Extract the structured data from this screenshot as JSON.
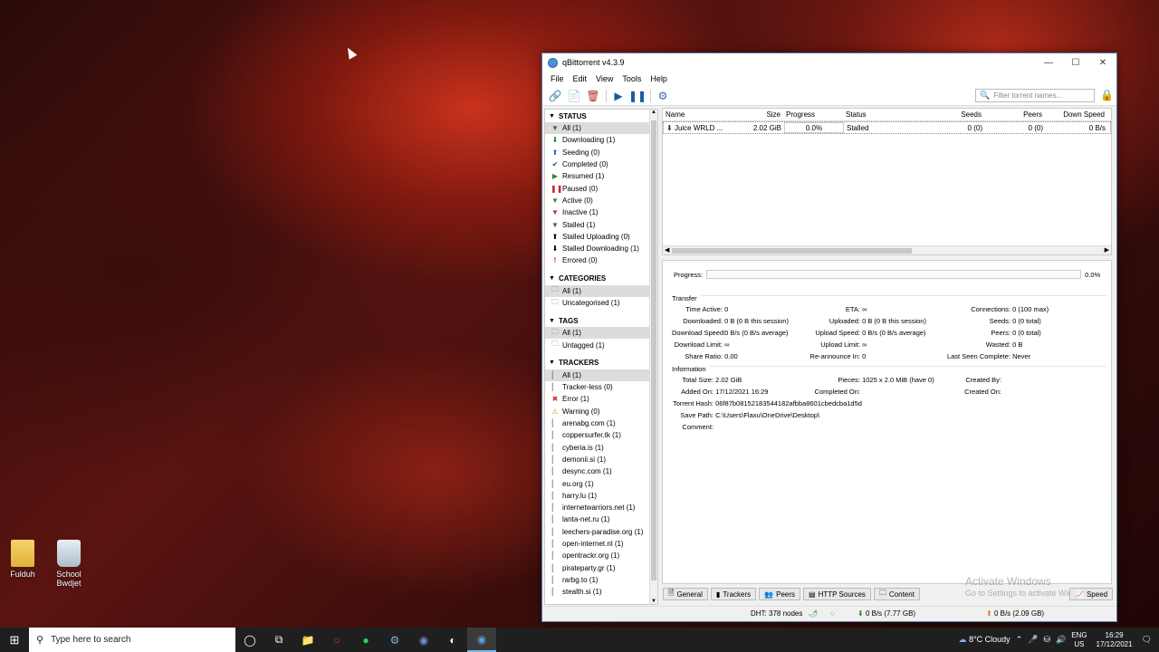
{
  "desktop": {
    "icons": [
      {
        "label": "Fulduh"
      },
      {
        "label": "School Bwdjet"
      }
    ]
  },
  "window": {
    "title": "qBittorrent v4.3.9",
    "menu": [
      "File",
      "Edit",
      "View",
      "Tools",
      "Help"
    ],
    "search_placeholder": "Filter torrent names..."
  },
  "sidebar": {
    "status_title": "STATUS",
    "status": [
      "All (1)",
      "Downloading (1)",
      "Seeding (0)",
      "Completed (0)",
      "Resumed (1)",
      "Paused (0)",
      "Active (0)",
      "Inactive (1)",
      "Stalled (1)",
      "Stalled Uploading (0)",
      "Stalled Downloading (1)",
      "Errored (0)"
    ],
    "categories_title": "CATEGORIES",
    "categories": [
      "All (1)",
      "Uncategorised (1)"
    ],
    "tags_title": "TAGS",
    "tags": [
      "All (1)",
      "Untagged (1)"
    ],
    "trackers_title": "TRACKERS",
    "trackers": [
      "All (1)",
      "Tracker-less (0)",
      "Error (1)",
      "Warning (0)",
      "arenabg.com (1)",
      "coppersurfer.tk (1)",
      "cyberia.is (1)",
      "demonii.si (1)",
      "desync.com (1)",
      "eu.org (1)",
      "harry.lu (1)",
      "internetwarriors.net (1)",
      "lanta-net.ru (1)",
      "leechers-paradise.org (1)",
      "open-internet.nl (1)",
      "opentrackr.org (1)",
      "pirateparty.gr (1)",
      "rarbg.to (1)",
      "stealth.si (1)"
    ]
  },
  "torrents": {
    "columns": [
      "Name",
      "Size",
      "Progress",
      "Status",
      "Seeds",
      "Peers",
      "Down Speed"
    ],
    "rows": [
      {
        "name": "Juice WRLD ...",
        "size": "2.02 GiB",
        "progress": "0.0%",
        "status": "Stalled",
        "seeds": "0 (0)",
        "peers": "0 (0)",
        "down_speed": "0 B/s"
      }
    ]
  },
  "details": {
    "progress_label": "Progress:",
    "progress_value": "0.0%",
    "transfer_title": "Transfer",
    "transfer": {
      "time_active": [
        "Time Active:",
        "0"
      ],
      "downloaded": [
        "Downloaded:",
        "0 B (0 B this session)"
      ],
      "download_speed": [
        "Download Speed:",
        "0 B/s (0 B/s average)"
      ],
      "download_limit": [
        "Download Limit:",
        "∞"
      ],
      "share_ratio": [
        "Share Ratio:",
        "0.00"
      ],
      "eta": [
        "ETA:",
        "∞"
      ],
      "uploaded": [
        "Uploaded:",
        "0 B (0 B this session)"
      ],
      "upload_speed": [
        "Upload Speed:",
        "0 B/s (0 B/s average)"
      ],
      "upload_limit": [
        "Upload Limit:",
        "∞"
      ],
      "reannounce": [
        "Re-announce In:",
        "0"
      ],
      "connections": [
        "Connections:",
        "0 (100 max)"
      ],
      "seeds": [
        "Seeds:",
        "0 (0 total)"
      ],
      "peers": [
        "Peers:",
        "0 (0 total)"
      ],
      "wasted": [
        "Wasted:",
        "0 B"
      ],
      "last_seen": [
        "Last Seen Complete:",
        "Never"
      ]
    },
    "info_title": "Information",
    "info": {
      "total_size": [
        "Total Size:",
        "2.02 GiB"
      ],
      "added_on": [
        "Added On:",
        "17/12/2021 16:29"
      ],
      "hash": [
        "Torrent Hash:",
        "06f87b08152183544182afbba8601cbedcba1d5d"
      ],
      "save_path": [
        "Save Path:",
        "C:\\Users\\Flaxu\\OneDrive\\Desktop\\"
      ],
      "comment": [
        "Comment:",
        ""
      ],
      "pieces": [
        "Pieces:",
        "1025 x 2.0 MiB (have 0)"
      ],
      "completed_on": [
        "Completed On:",
        ""
      ],
      "created_by": [
        "Created By:",
        ""
      ],
      "created_on": [
        "Created On:",
        ""
      ]
    },
    "watermark_1": "Activate Windows",
    "watermark_2": "Go to Settings to activate Windows."
  },
  "tabs": [
    "General",
    "Trackers",
    "Peers",
    "HTTP Sources",
    "Content"
  ],
  "speed_tab": "Speed",
  "statusbar": {
    "dht": "DHT: 378 nodes",
    "down": "0 B/s (7.77 GB)",
    "up": "0 B/s (2.09 GB)"
  },
  "taskbar": {
    "search_placeholder": "Type here to search",
    "weather": "8°C  Cloudy",
    "lang_1": "ENG",
    "lang_2": "US",
    "time": "16:29",
    "date": "17/12/2021"
  }
}
